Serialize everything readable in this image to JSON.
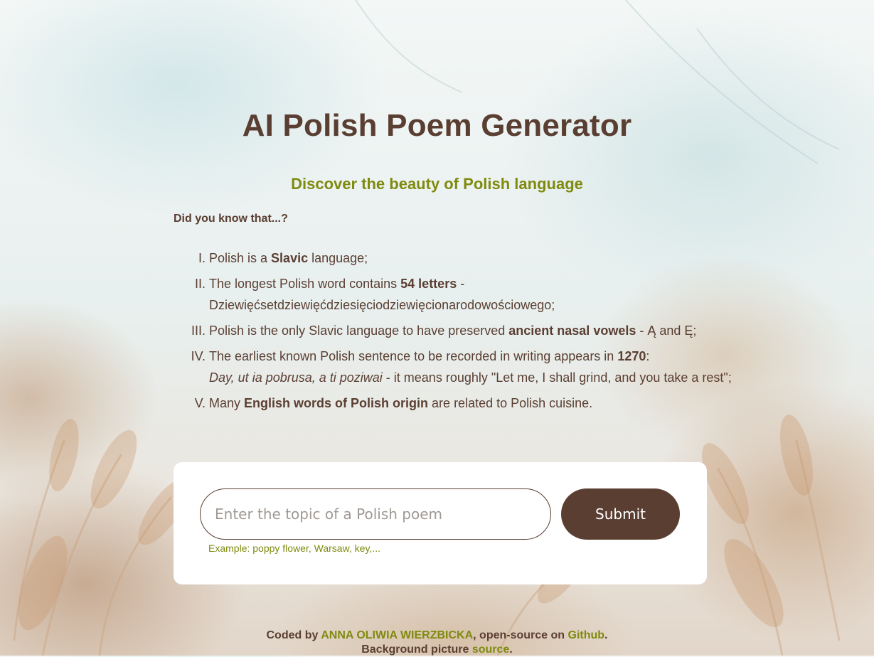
{
  "header": {
    "title": "AI Polish Poem Generator",
    "subtitle": "Discover the beauty of Polish language",
    "intro": "Did you know that...?"
  },
  "facts": [
    {
      "a": "Polish is a ",
      "b": "Slavic",
      "c": " language;"
    },
    {
      "a": "The longest Polish word contains ",
      "b": "54 letters",
      "c": " - Dziewięćsetdziewięćdziesięciodziewięcionarodowościowego;"
    },
    {
      "a": "Polish is the only Slavic language to have preserved ",
      "b": "ancient nasal vowels",
      "c": " - Ą and Ę;"
    },
    {
      "a": "The earliest known Polish sentence to be recorded in writing appears in ",
      "b": "1270",
      "c": ":",
      "quote": "Day, ut ia pobrusa, a ti poziwai",
      "d": " - it means roughly \"Let me, I shall grind, and you take a rest\";"
    },
    {
      "a": "Many ",
      "b": "English words of Polish origin",
      "c": " are related to Polish cuisine."
    }
  ],
  "form": {
    "placeholder": "Enter the topic of a Polish poem",
    "value": "",
    "submit_label": "Submit",
    "hint": "Example: poppy flower, Warsaw, key,..."
  },
  "footer": {
    "coded_by": "Coded by ",
    "author": "ANNA OLIWIA WIERZBICKA",
    "open_source": ", open-source on ",
    "github": "Github",
    "period1": ".",
    "bg_text": "Background picture ",
    "source": "source",
    "period2": "."
  },
  "colors": {
    "primary": "#5a3e32",
    "accent": "#7f8a0e",
    "card": "#ffffff"
  }
}
